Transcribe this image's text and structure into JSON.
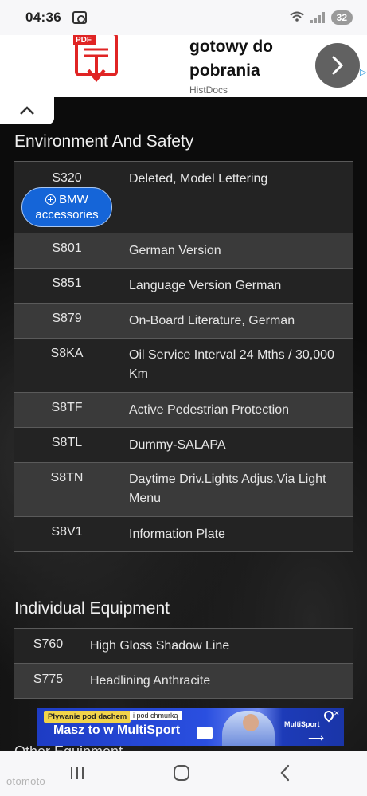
{
  "status_bar": {
    "time": "04:36",
    "battery": "32"
  },
  "ad_top": {
    "pdf_label": "PDF",
    "title_line1": "gotowy do",
    "title_line2": "pobrania",
    "source": "HistDocs"
  },
  "section1": {
    "title": "Environment And Safety",
    "button_line1": "BMW",
    "button_line2": "accessories",
    "rows": [
      {
        "code": "S320",
        "desc": "Deleted, Model Lettering"
      },
      {
        "code": "S801",
        "desc": "German Version"
      },
      {
        "code": "S851",
        "desc": "Language Version German"
      },
      {
        "code": "S879",
        "desc": "On-Board Literature, German"
      },
      {
        "code": "S8KA",
        "desc": "Oil Service Interval 24 Mths / 30,000 Km"
      },
      {
        "code": "S8TF",
        "desc": "Active Pedestrian Protection"
      },
      {
        "code": "S8TL",
        "desc": "Dummy-SALAPA"
      },
      {
        "code": "S8TN",
        "desc": "Daytime Driv.Lights Adjus.Via Light Menu"
      },
      {
        "code": "S8V1",
        "desc": "Information Plate"
      }
    ]
  },
  "section2": {
    "title": "Individual Equipment",
    "rows": [
      {
        "code": "S760",
        "desc": "High Gloss Shadow Line"
      },
      {
        "code": "S775",
        "desc": "Headlining Anthracite"
      }
    ]
  },
  "ad_bottom": {
    "tag": "Pływanie pod dachem",
    "tag2": "i pod chmurką",
    "headline": "Masz to w MultiSport",
    "brand": "MultiSport"
  },
  "next_section_partial": "Other Equipment",
  "watermark": "otomoto",
  "colors": {
    "accent_button": "#1565d8",
    "row_dark": "#232323",
    "row_light": "#3a3a3a"
  }
}
